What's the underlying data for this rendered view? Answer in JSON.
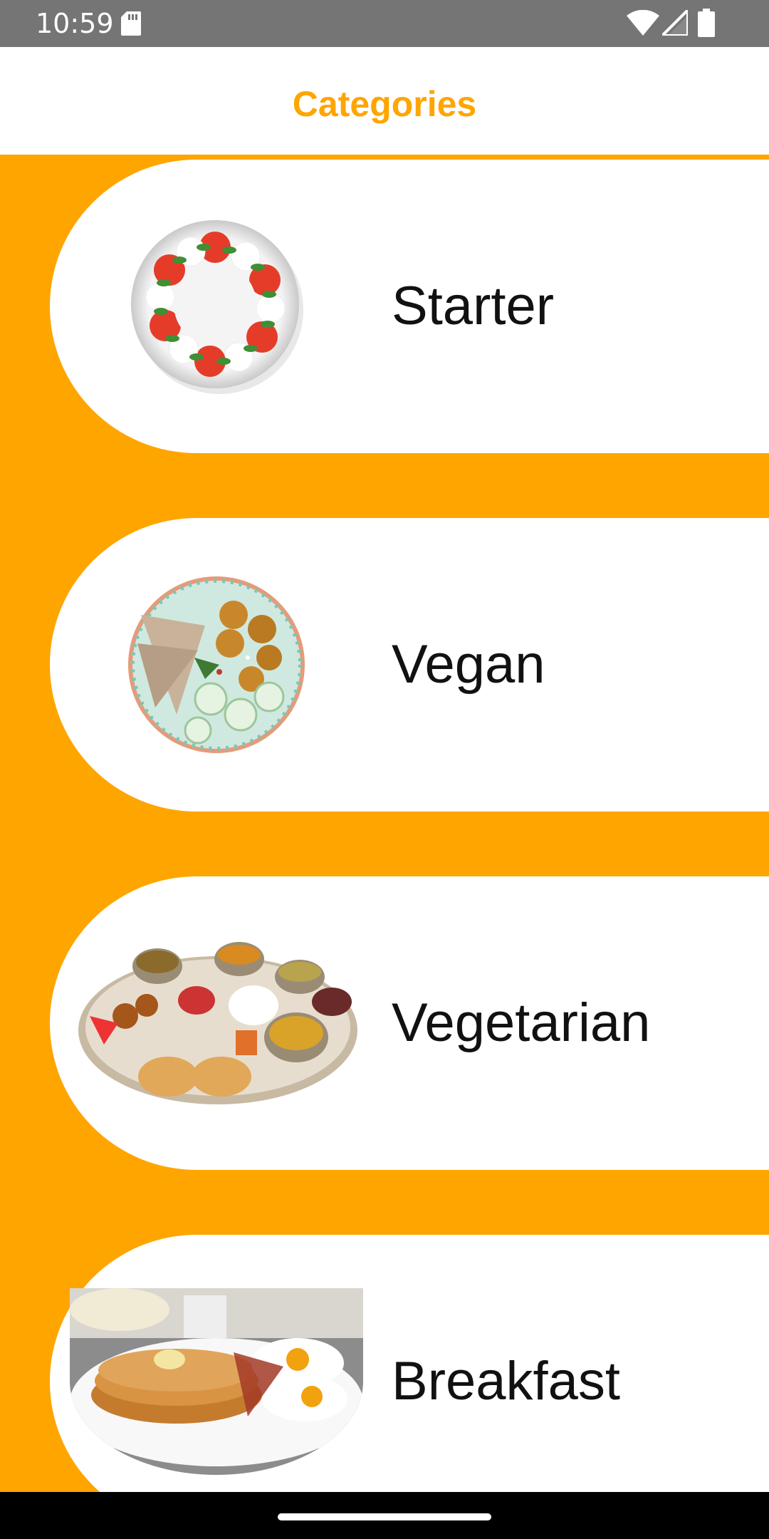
{
  "status_bar": {
    "time": "10:59",
    "icons": [
      "sd-card-icon",
      "wifi-icon",
      "signal-icon",
      "battery-icon"
    ]
  },
  "app_bar": {
    "title": "Categories"
  },
  "colors": {
    "accent": "#FFA500",
    "card_background": "#FFFFFF",
    "status_bar": "#757575",
    "nav_bar": "#000000"
  },
  "categories": [
    {
      "label": "Starter",
      "image": "caprese-salad-plate-image"
    },
    {
      "label": "Vegan",
      "image": "vegan-bowl-image"
    },
    {
      "label": "Vegetarian",
      "image": "vegetarian-thali-image"
    },
    {
      "label": "Breakfast",
      "image": "pancakes-eggs-image"
    }
  ]
}
